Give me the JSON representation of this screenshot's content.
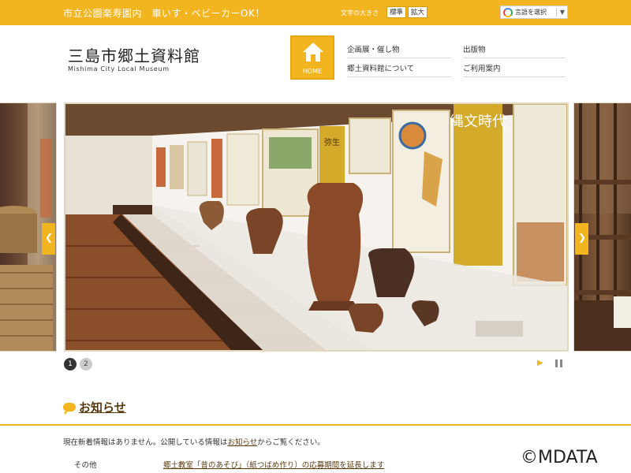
{
  "topbar": {
    "tagline": "市立公園楽寿園内　車いす・ベビーカーOK！",
    "font_size_label": "文字の大きさ",
    "font_size_normal": "標準",
    "font_size_large": "拡大",
    "language_select": "言語を選択",
    "language_caret": "▼"
  },
  "header": {
    "title": "三島市郷土資料館",
    "subtitle": "Mishima City Local Museum",
    "home_label": "HOME"
  },
  "nav": {
    "items": [
      "企画展・催し物",
      "出版物",
      "郷土資料館について",
      "ご利用案内"
    ]
  },
  "slider": {
    "exhibit_sign_1": "縄文時代",
    "exhibit_sign_2": "弥生",
    "pages": [
      "1",
      "2"
    ],
    "prev_glyph": "❮",
    "next_glyph": "❯",
    "play_glyph": "▶"
  },
  "news": {
    "heading": "お知らせ",
    "message_prefix": "現在新着情報はありません。公開している情報は",
    "message_link": "お知らせ",
    "message_suffix": "からご覧ください。",
    "item_category": "その他",
    "item_title": "郷土教室「昔のあそび」（紙つばめ作り）の応募期間を延長します"
  },
  "copyright": "©MDATA",
  "colors": {
    "accent": "#f3b51f",
    "heading_brown": "#5a3a0d"
  }
}
